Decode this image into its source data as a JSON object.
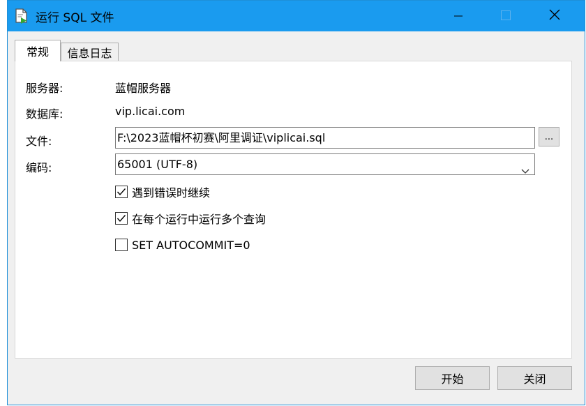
{
  "window": {
    "title": "运行 SQL 文件"
  },
  "tabs": [
    {
      "label": "常规",
      "active": true
    },
    {
      "label": "信息日志",
      "active": false
    }
  ],
  "form": {
    "server_label": "服务器:",
    "server_value": "蓝帽服务器",
    "database_label": "数据库:",
    "database_value": "vip.licai.com",
    "file_label": "文件:",
    "file_value": "F:\\2023蓝帽杯初赛\\阿里调证\\viplicai.sql",
    "browse_label": "...",
    "encoding_label": "编码:",
    "encoding_value": "65001 (UTF-8)"
  },
  "options": [
    {
      "label": "遇到错误时继续",
      "checked": true
    },
    {
      "label": "在每个运行中运行多个查询",
      "checked": true
    },
    {
      "label": "SET AUTOCOMMIT=0",
      "checked": false
    }
  ],
  "buttons": {
    "start": "开始",
    "close": "关闭"
  },
  "colors": {
    "titlebar": "#1a9bef",
    "window_bg": "#f0f0f0"
  },
  "icons": {
    "title": "sql-file-run-icon",
    "minimize": "minimize-icon",
    "maximize": "maximize-icon",
    "close": "close-icon",
    "dropdown": "chevron-down-icon",
    "check": "checkmark-icon"
  }
}
